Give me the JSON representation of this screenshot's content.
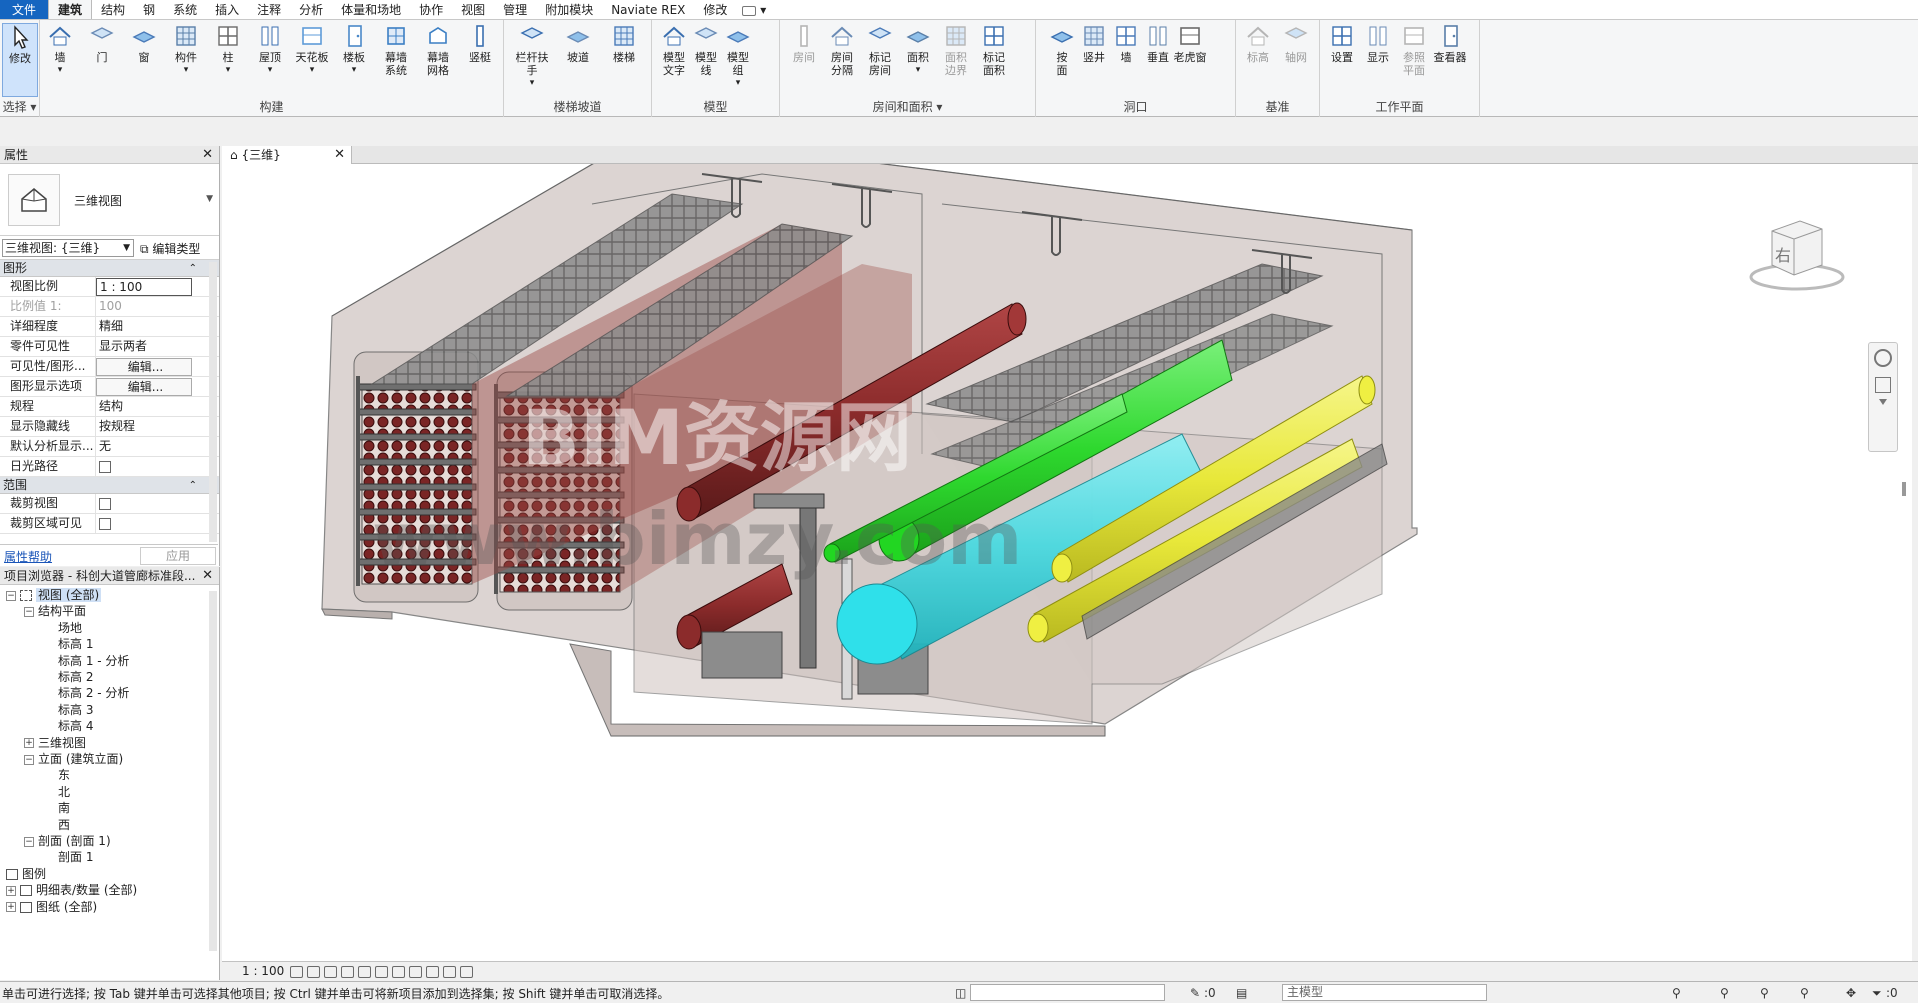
{
  "menu": {
    "tabs": [
      "文件",
      "建筑",
      "结构",
      "钢",
      "系统",
      "插入",
      "注释",
      "分析",
      "体量和场地",
      "协作",
      "视图",
      "管理",
      "附加模块",
      "Naviate REX",
      "修改"
    ],
    "active": "建筑"
  },
  "ribbon": {
    "select": {
      "modify": "修改",
      "group": "选择"
    },
    "build": {
      "title": "构建",
      "items": [
        "墙",
        "门",
        "窗",
        "构件",
        "柱",
        "屋顶",
        "天花板",
        "楼板",
        "幕墙\n系统",
        "幕墙\n网格",
        "竖梃"
      ]
    },
    "stairs": {
      "title": "楼梯坡道",
      "items": [
        "栏杆扶手",
        "坡道",
        "楼梯"
      ]
    },
    "model": {
      "title": "模型",
      "items": [
        "模型\n文字",
        "模型\n线",
        "模型\n组"
      ]
    },
    "room": {
      "title": "房间和面积",
      "items": [
        "房间",
        "房间\n分隔",
        "标记\n房间",
        "面积",
        "面积\n边界",
        "标记\n面积"
      ]
    },
    "opening": {
      "title": "洞口",
      "items": [
        "按\n面",
        "竖井",
        "墙",
        "垂直",
        "老虎窗"
      ]
    },
    "datum": {
      "title": "基准",
      "items": [
        "标高",
        "轴网"
      ]
    },
    "workplane": {
      "title": "工作平面",
      "items": [
        "设置",
        "显示",
        "参照\n平面",
        "查看器"
      ]
    }
  },
  "properties": {
    "title": "属性",
    "type_name": "三维视图",
    "instance": "三维视图: {三维}",
    "edit_type": "编辑类型",
    "group_graphics": "图形",
    "rows": [
      {
        "k": "视图比例",
        "v": "1 : 100"
      },
      {
        "k": "比例值 1:",
        "v": "100"
      },
      {
        "k": "详细程度",
        "v": "精细"
      },
      {
        "k": "零件可见性",
        "v": "显示两者"
      },
      {
        "k": "可见性/图形...",
        "v": "编辑..."
      },
      {
        "k": "图形显示选项",
        "v": "编辑..."
      },
      {
        "k": "规程",
        "v": "结构"
      },
      {
        "k": "显示隐藏线",
        "v": "按规程"
      },
      {
        "k": "默认分析显示...",
        "v": "无"
      },
      {
        "k": "日光路径",
        "v": ""
      }
    ],
    "group_extents": "范围",
    "rows2": [
      {
        "k": "裁剪视图",
        "v": ""
      },
      {
        "k": "裁剪区域可见",
        "v": ""
      }
    ],
    "help": "属性帮助",
    "apply": "应用"
  },
  "browser": {
    "title": "项目浏览器 - 科创大道管廊标准段...",
    "nodes": [
      {
        "label": "视图 (全部)",
        "level": 0,
        "toggle": "−",
        "sel": true
      },
      {
        "label": "结构平面",
        "level": 1,
        "toggle": "−"
      },
      {
        "label": "场地",
        "level": 2
      },
      {
        "label": "标高 1",
        "level": 2
      },
      {
        "label": "标高 1 - 分析",
        "level": 2
      },
      {
        "label": "标高 2",
        "level": 2
      },
      {
        "label": "标高 2 - 分析",
        "level": 2
      },
      {
        "label": "标高 3",
        "level": 2
      },
      {
        "label": "标高 4",
        "level": 2
      },
      {
        "label": "三维视图",
        "level": 1,
        "toggle": "+"
      },
      {
        "label": "立面 (建筑立面)",
        "level": 1,
        "toggle": "−"
      },
      {
        "label": "东",
        "level": 2
      },
      {
        "label": "北",
        "level": 2
      },
      {
        "label": "南",
        "level": 2
      },
      {
        "label": "西",
        "level": 2
      },
      {
        "label": "剖面 (剖面 1)",
        "level": 1,
        "toggle": "−"
      },
      {
        "label": "剖面 1",
        "level": 2
      },
      {
        "label": "图例",
        "level": 0,
        "icon": true
      },
      {
        "label": "明细表/数量 (全部)",
        "level": 0,
        "icon": true,
        "toggle": "+"
      },
      {
        "label": "图纸 (全部)",
        "level": 0,
        "icon": true,
        "toggle": "+"
      }
    ]
  },
  "view": {
    "tab_label": "{三维}",
    "watermark_cn": "BIM资源网",
    "watermark_url": "www.bimzy.com",
    "cube_label": "右",
    "scale": "1 : 100"
  },
  "status": {
    "message": "单击可进行选择; 按 Tab 键并单击可选择其他项目; 按 Ctrl 键并单击可将新项目添加到选择集; 按 Shift 键并单击可取消选择。",
    "count1": ":0",
    "model": "主模型",
    "filter": ":0"
  },
  "colors": {
    "accent": "#1565c0",
    "pipe_red": "#8b2b2b",
    "pipe_green": "#2ed82e",
    "pipe_cyan": "#2fd6e0",
    "pipe_yellow": "#e8e83a",
    "concrete": "#c9bfbb"
  }
}
